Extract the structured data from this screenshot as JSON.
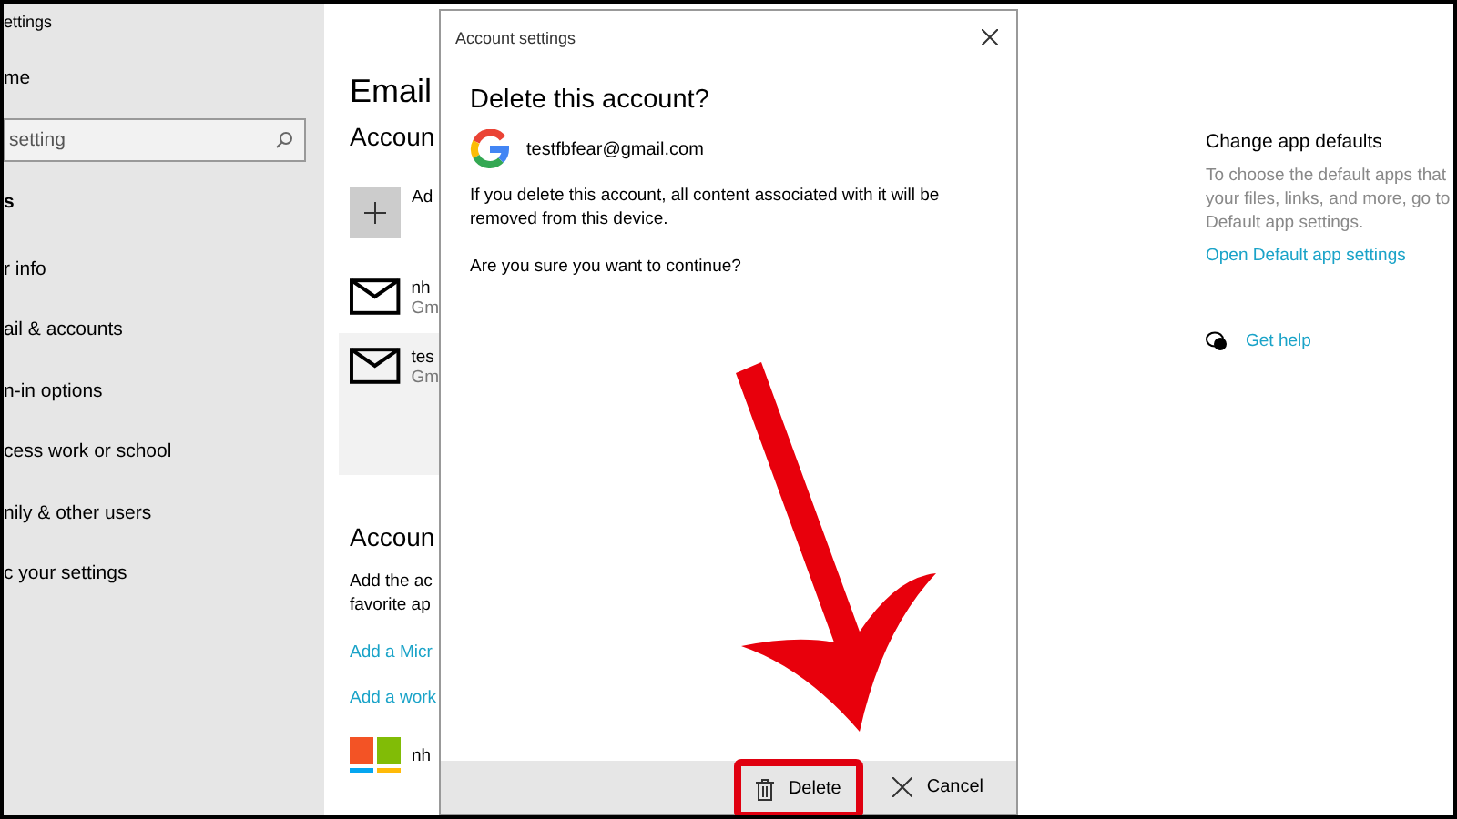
{
  "window": {
    "title": "ettings"
  },
  "sidebar": {
    "home": "me",
    "search": {
      "value": "setting"
    },
    "section": "s",
    "items": [
      "r info",
      "ail & accounts",
      "n-in options",
      "cess work or school",
      "nily & other users",
      "c your settings"
    ]
  },
  "main": {
    "title": "Email",
    "accounts_heading": "Accoun",
    "add_label": "Ad",
    "accounts": [
      {
        "name": "nh",
        "provider": "Gm",
        "selected": false
      },
      {
        "name": "tes",
        "provider": "Gm",
        "selected": true
      }
    ],
    "other_heading": "Accoun",
    "other_text": [
      "Add the ac",
      "favorite ap"
    ],
    "links": [
      "Add a Micr",
      "Add a work"
    ],
    "ms_account": "nh"
  },
  "related": {
    "heading": "Change app defaults",
    "text": [
      "To choose the default apps that",
      "your files, links, and more, go to",
      "Default app settings."
    ],
    "link": "Open Default app settings",
    "help": "Get help"
  },
  "dialog": {
    "title": "Account settings",
    "heading": "Delete this account?",
    "email": "testfbfear@gmail.com",
    "message": "If you delete this account, all content associated with it will be removed from this device.",
    "question": "Are you sure you want to continue?",
    "buttons": [
      {
        "kind": "delete",
        "label": "Delete",
        "highlighted": true
      },
      {
        "kind": "cancel",
        "label": "Cancel",
        "highlighted": false
      }
    ]
  }
}
